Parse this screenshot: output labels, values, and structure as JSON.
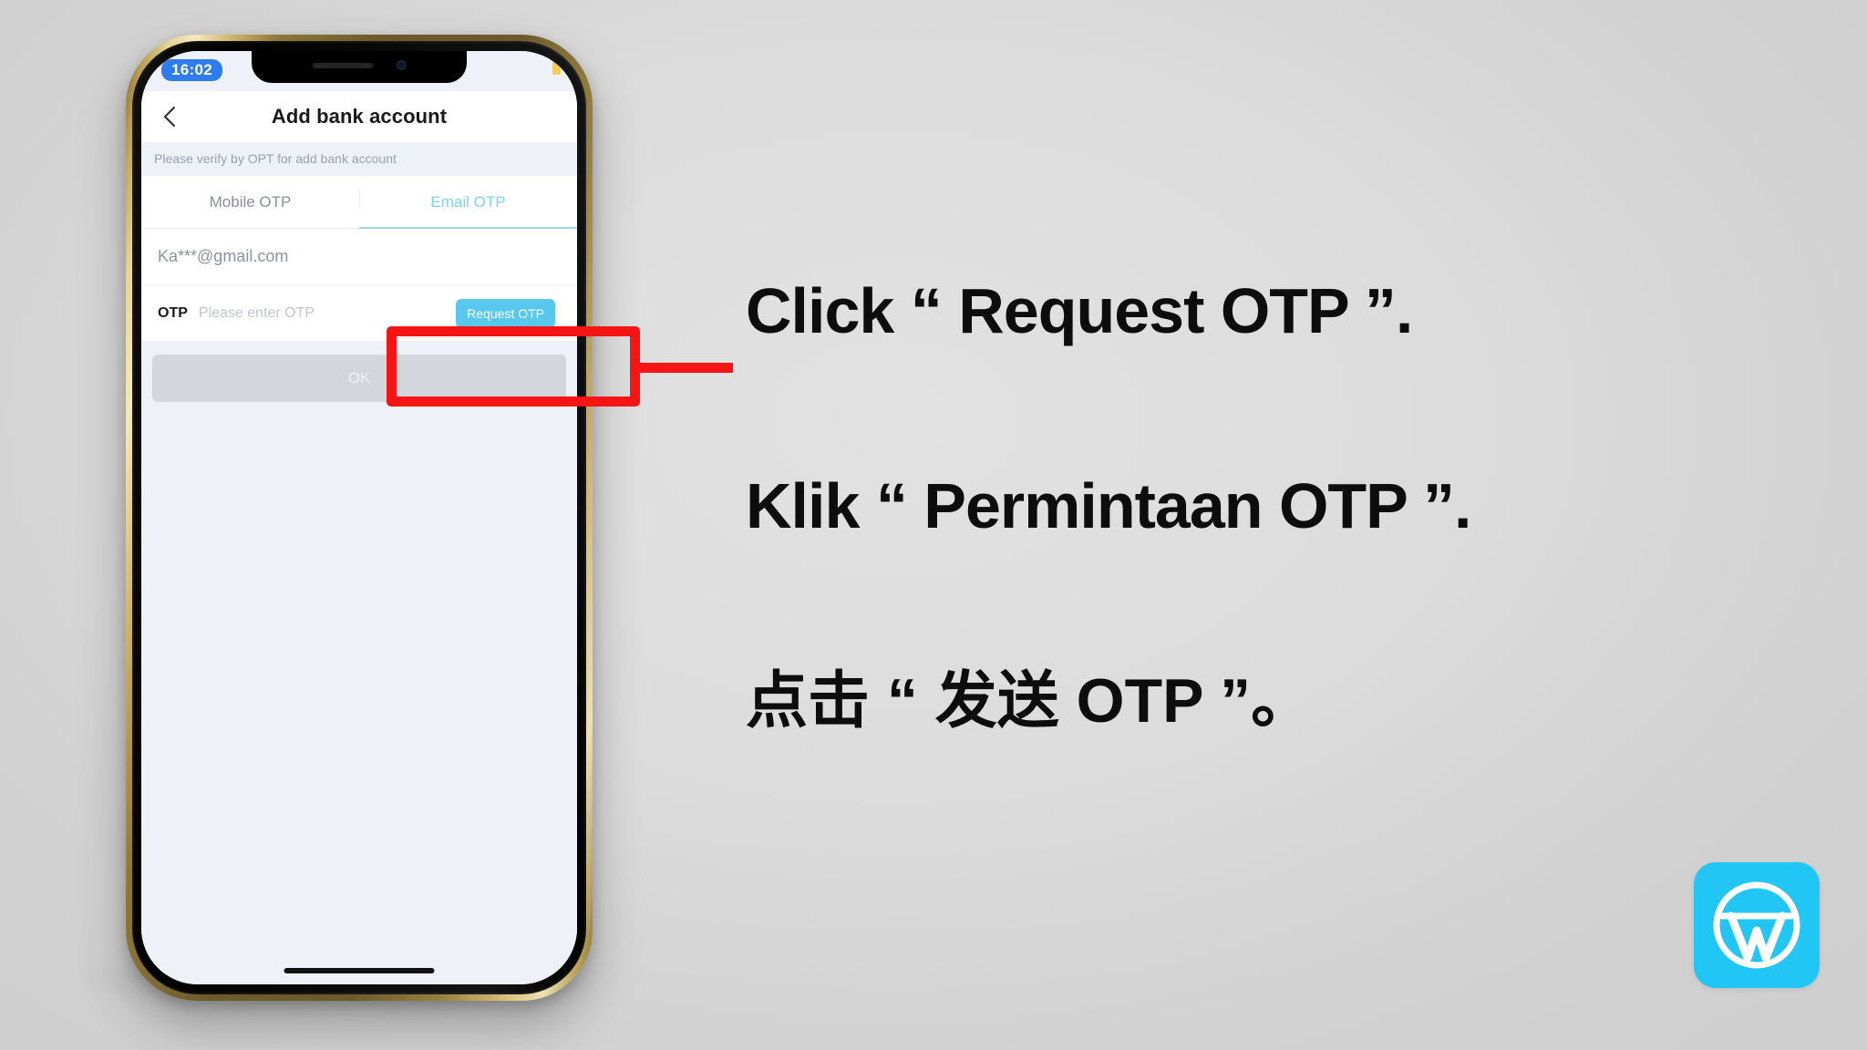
{
  "phone": {
    "status_bar": {
      "time": "16:02",
      "battery_icon": "battery-icon"
    },
    "nav": {
      "back_icon": "chevron-left-icon",
      "title": "Add bank account"
    },
    "hint": "Please verify by OPT for add bank account",
    "tabs": [
      {
        "id": "mobile-otp",
        "label": "Mobile OTP",
        "active": false
      },
      {
        "id": "email-otp",
        "label": "Email OTP",
        "active": true
      }
    ],
    "email_row": {
      "value": "Ka***@gmail.com"
    },
    "otp_row": {
      "label": "OTP",
      "placeholder": "Please enter OTP",
      "value": "",
      "button_label": "Request OTP"
    },
    "submit": {
      "label": "OK"
    }
  },
  "annotation": {
    "highlight_color": "#f51515",
    "target": "Request OTP"
  },
  "instructions": {
    "line_en": "Click “ Request OTP ”.",
    "line_id": "Klik “ Permintaan OTP ”.",
    "line_zh": "点击 “ 发送 OTP ”。"
  },
  "logo": {
    "name": "w-logo",
    "letter": "W",
    "background_color": "#22c6f5",
    "mark_color": "#ffffff"
  },
  "colors": {
    "accent": "#58c8ef",
    "tab_active": "#7fd4e8",
    "time_pill": "#2e7ced",
    "screen_bg": "#eef1f8"
  }
}
